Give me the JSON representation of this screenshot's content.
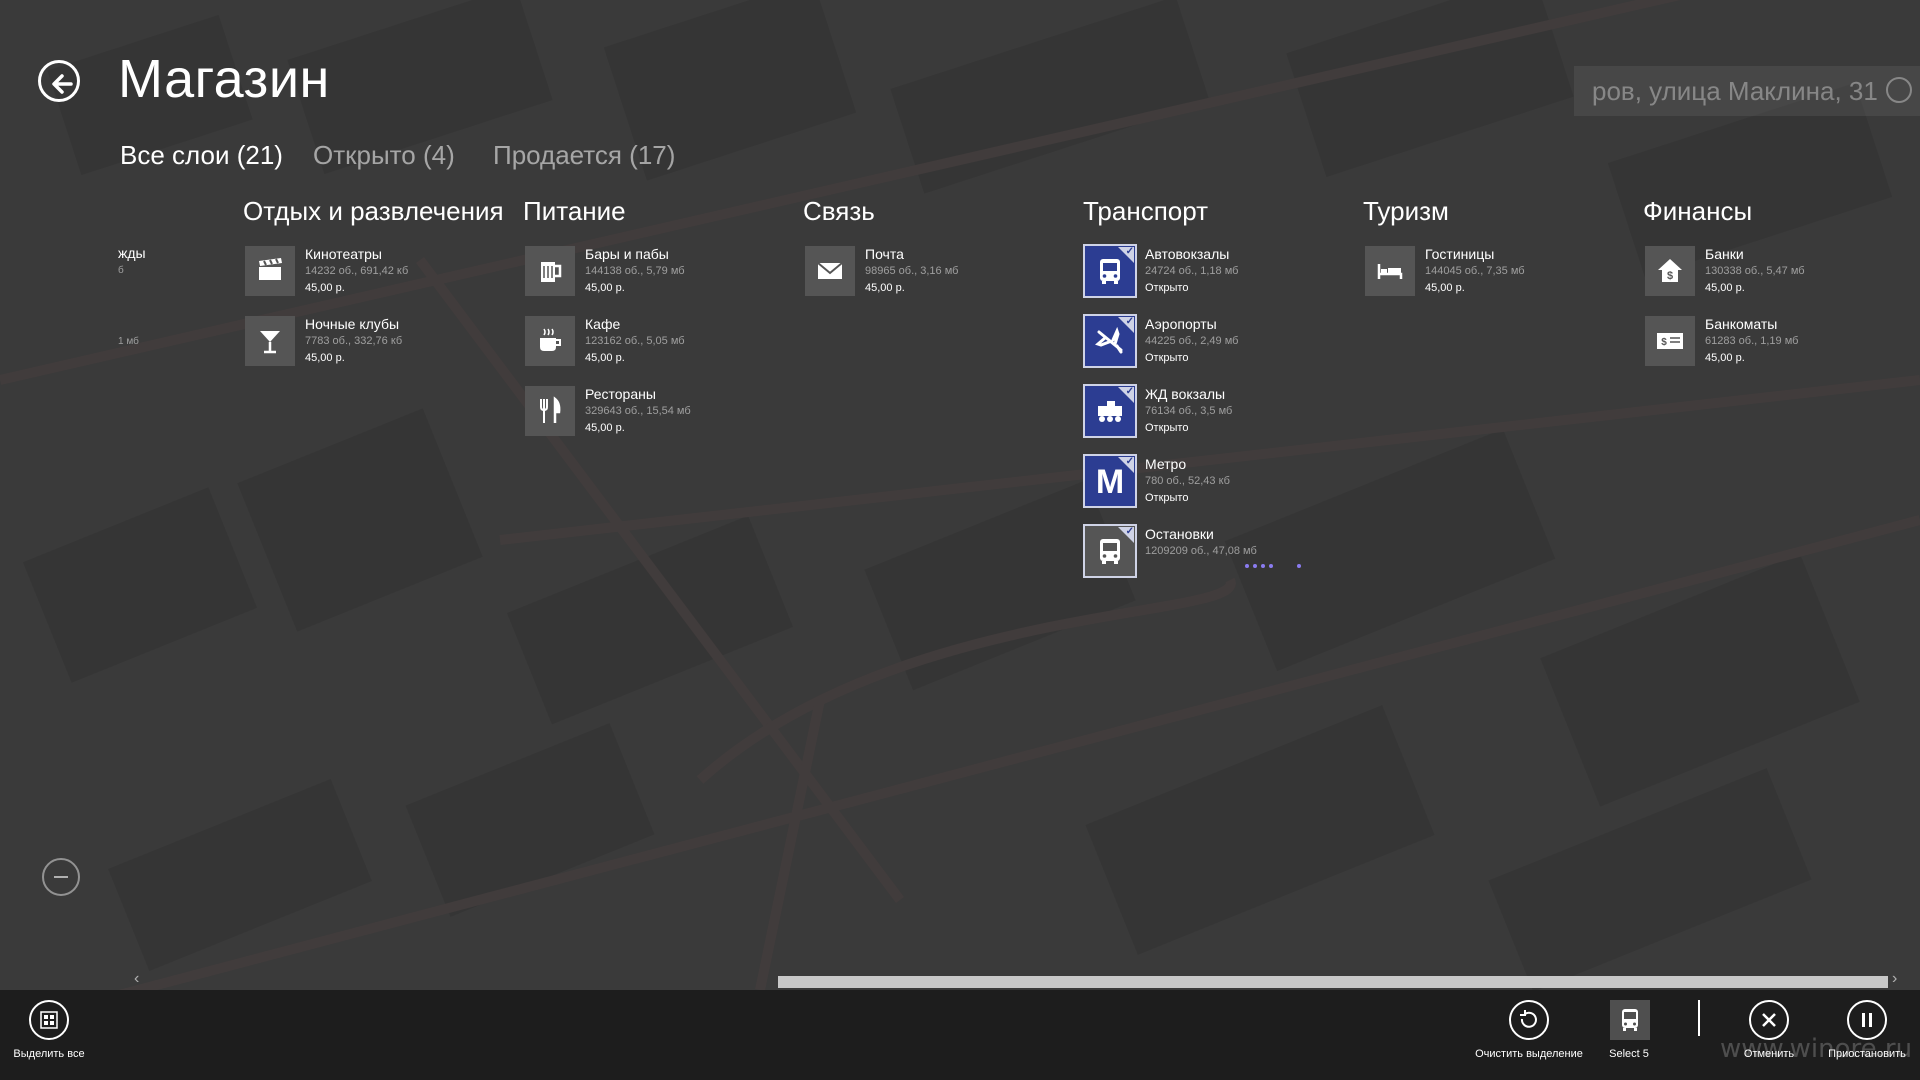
{
  "header": {
    "title": "Магазин",
    "address": "ров, улица Маклина, 31"
  },
  "filters": [
    {
      "label": "Все слои (21)",
      "active": true
    },
    {
      "label": "Открыто (4)",
      "active": false
    },
    {
      "label": "Продается (17)",
      "active": false
    }
  ],
  "partial_column": {
    "name": "жды",
    "meta": "б",
    "meta2": "1 мб"
  },
  "categories": [
    {
      "title": "Отдых и развлечения",
      "items": [
        {
          "name": "Кинотеатры",
          "meta": "14232 об., 691,42 кб",
          "status": "45,00 р.",
          "icon": "clapperboard-icon",
          "selected": false
        },
        {
          "name": "Ночные клубы",
          "meta": "7783 об., 332,76 кб",
          "status": "45,00 р.",
          "icon": "cocktail-icon",
          "selected": false
        }
      ]
    },
    {
      "title": "Питание",
      "items": [
        {
          "name": "Бары и пабы",
          "meta": "144138 об., 5,79 мб",
          "status": "45,00 р.",
          "icon": "beer-mug-icon",
          "selected": false
        },
        {
          "name": "Кафе",
          "meta": "123162 об., 5,05 мб",
          "status": "45,00 р.",
          "icon": "coffee-cup-icon",
          "selected": false
        },
        {
          "name": "Рестораны",
          "meta": "329643 об., 15,54 мб",
          "status": "45,00 р.",
          "icon": "fork-knife-icon",
          "selected": false
        }
      ]
    },
    {
      "title": "Связь",
      "items": [
        {
          "name": "Почта",
          "meta": "98965 об., 3,16 мб",
          "status": "45,00 р.",
          "icon": "envelope-icon",
          "selected": false
        }
      ]
    },
    {
      "title": "Транспорт",
      "items": [
        {
          "name": "Автовокзалы",
          "meta": "24724 об., 1,18 мб",
          "status": "Открыто",
          "icon": "bus-icon",
          "selected": true
        },
        {
          "name": "Аэропорты",
          "meta": "44225 об., 2,49 мб",
          "status": "Открыто",
          "icon": "airplane-icon",
          "selected": true
        },
        {
          "name": "ЖД вокзалы",
          "meta": "76134 об., 3,5 мб",
          "status": "Открыто",
          "icon": "train-icon",
          "selected": true
        },
        {
          "name": "Метро",
          "meta": "780 об., 52,43 кб",
          "status": "Открыто",
          "icon": "metro-icon",
          "selected": true,
          "glyph": "M"
        },
        {
          "name": "Остановки",
          "meta": "1209209 об., 47,08 мб",
          "status": "",
          "icon": "bus-stop-icon",
          "selected": true
        }
      ]
    },
    {
      "title": "Туризм",
      "items": [
        {
          "name": "Гостиницы",
          "meta": "144045 об., 7,35 мб",
          "status": "45,00 р.",
          "icon": "bed-icon",
          "selected": false
        }
      ]
    },
    {
      "title": "Финансы",
      "items": [
        {
          "name": "Банки",
          "meta": "130338 об., 5,47 мб",
          "status": "45,00 р.",
          "icon": "bank-icon",
          "selected": false
        },
        {
          "name": "Банкоматы",
          "meta": "61283 об., 1,19 мб",
          "status": "45,00 р.",
          "icon": "atm-icon",
          "selected": false
        }
      ]
    }
  ],
  "app_bar": {
    "select_all": "Выделить все",
    "clear_selection": "Очистить выделение",
    "select_count": "Select 5",
    "cancel": "Отменить",
    "pause": "Приостановить"
  },
  "watermark": "www.winore.ru",
  "colors": {
    "selected_tile": "#2c3d92",
    "tile": "#555555",
    "app_bar": "#1d1d1d",
    "progress": "#8a7cf0"
  }
}
